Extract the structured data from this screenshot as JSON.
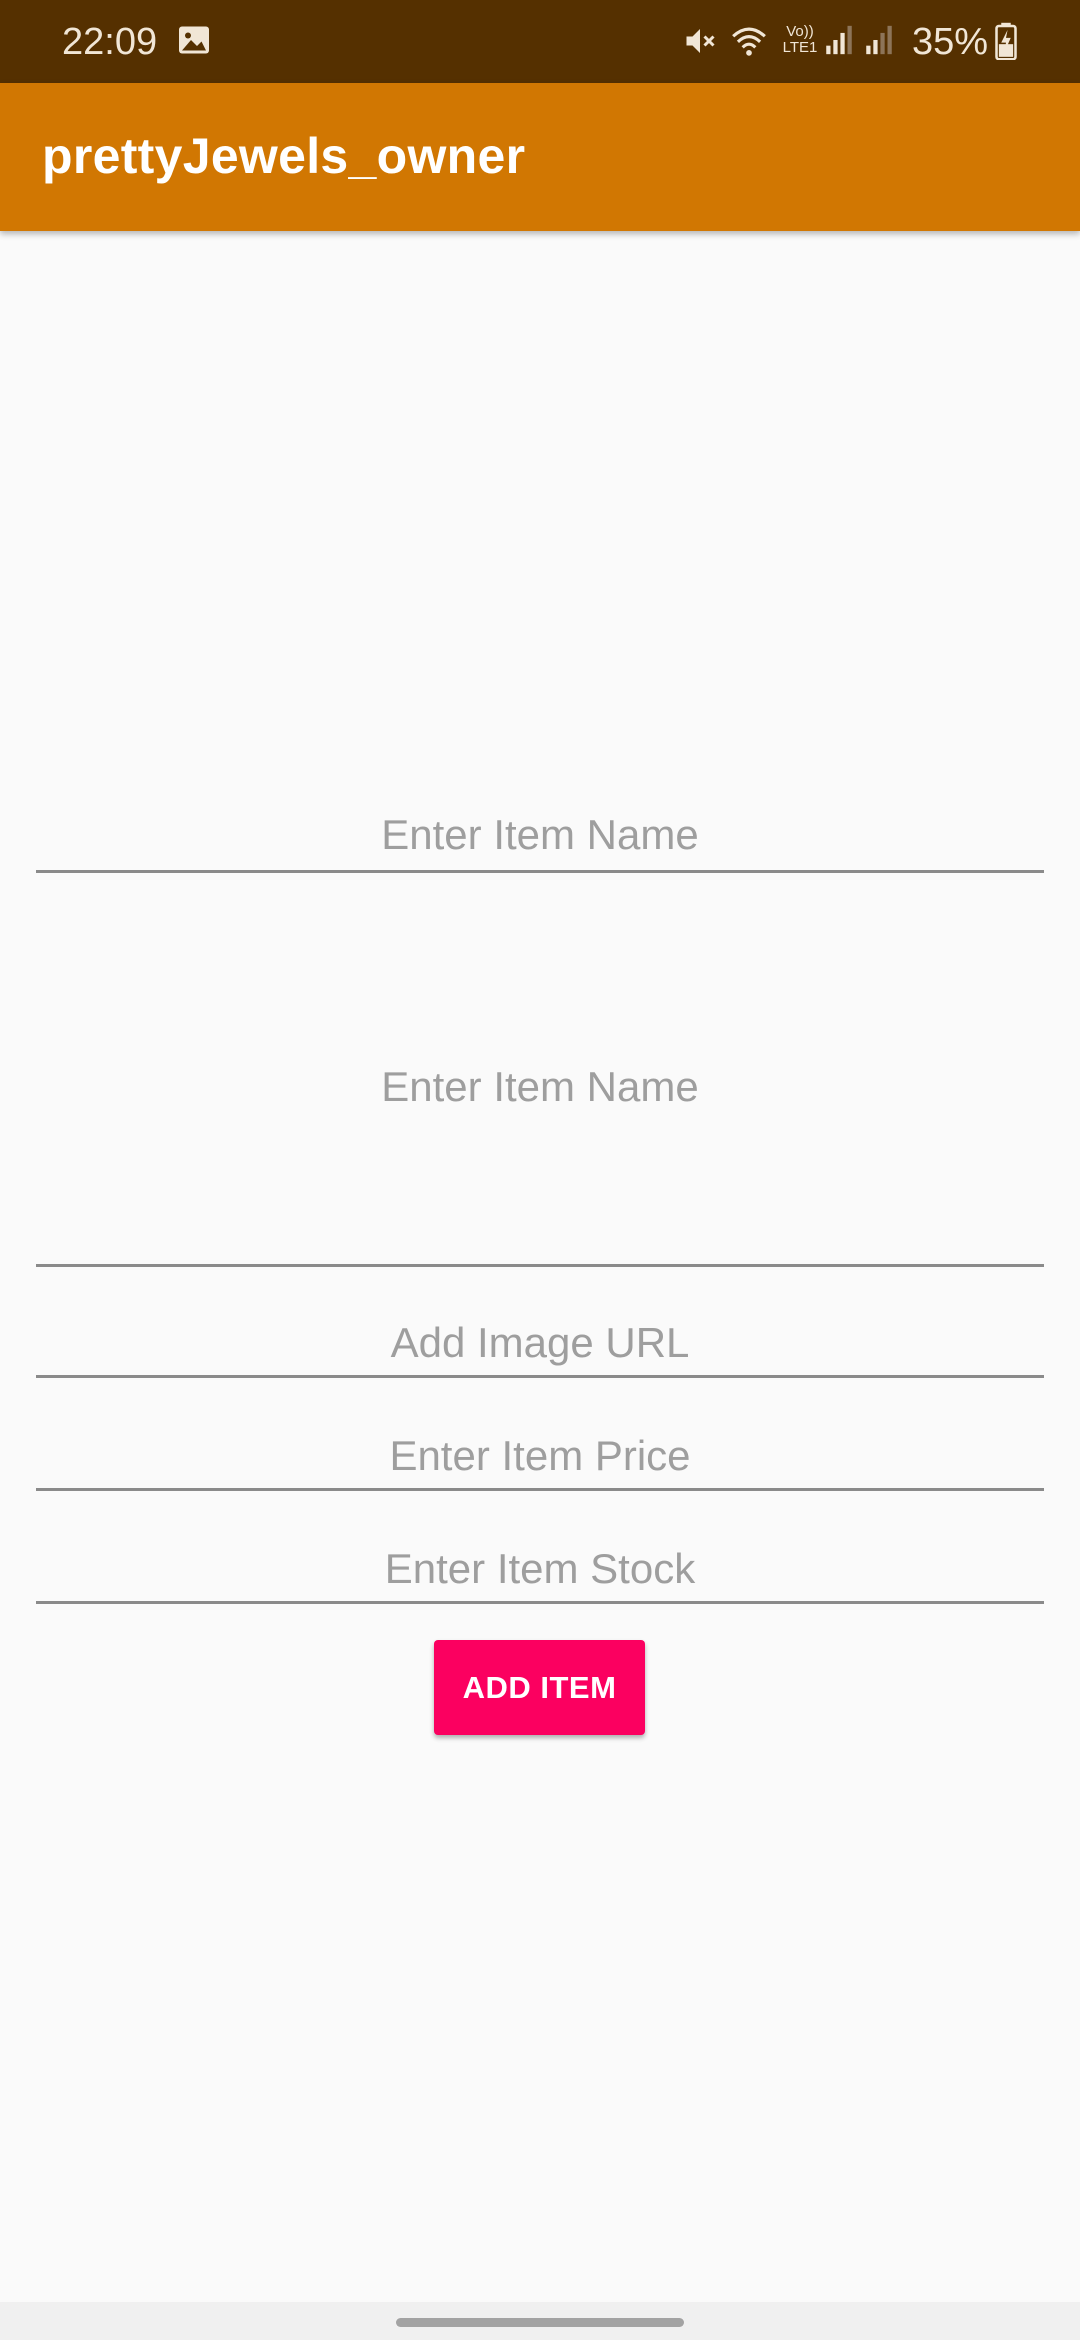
{
  "status_bar": {
    "time": "22:09",
    "icons": [
      "gallery-icon",
      "mute-icon",
      "wifi-icon",
      "volte-icon",
      "signal-icon",
      "signal-icon",
      "battery-charging-icon"
    ],
    "network_label_top": "Vo))",
    "network_label_bottom": "LTE1",
    "battery_text": "35%"
  },
  "app_bar": {
    "title": "prettyJewels_owner",
    "color": "#d17702"
  },
  "form": {
    "item_name_placeholder": "Enter Item Name",
    "item_description_placeholder": "Enter Item Name",
    "image_url_placeholder": "Add Image URL",
    "price_placeholder": "Enter Item Price",
    "stock_placeholder": "Enter Item Stock"
  },
  "add_button": {
    "label": "ADD ITEM",
    "color": "#fb0060"
  },
  "colors": {
    "status_bar": "#553000",
    "background": "#fafafa"
  }
}
